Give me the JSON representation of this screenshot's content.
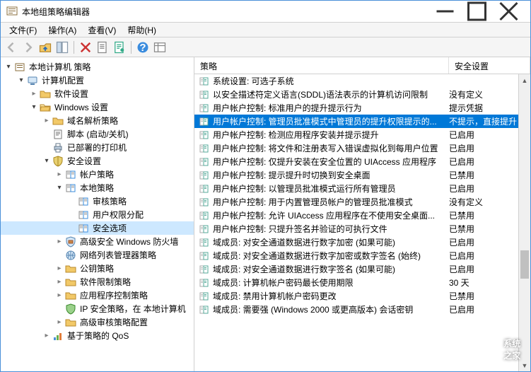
{
  "window": {
    "title": "本地组策略编辑器"
  },
  "menu": {
    "file": "文件(F)",
    "action": "操作(A)",
    "view": "查看(V)",
    "help": "帮助(H)"
  },
  "tree": {
    "root": "本地计算机 策略",
    "computer_config": "计算机配置",
    "software_settings": "软件设置",
    "windows_settings": "Windows 设置",
    "name_resolution": "域名解析策略",
    "scripts": "脚本 (启动/关机)",
    "deployed_printers": "已部署的打印机",
    "security_settings": "安全设置",
    "account_policies": "帐户策略",
    "local_policies": "本地策略",
    "audit_policy": "审核策略",
    "user_rights": "用户权限分配",
    "security_options": "安全选项",
    "advanced_firewall": "高级安全 Windows 防火墙",
    "network_list": "网络列表管理器策略",
    "public_key": "公钥策略",
    "software_restriction": "软件限制策略",
    "app_control": "应用程序控制策略",
    "ip_security": "IP 安全策略，在 本地计算机",
    "advanced_audit": "高级审核策略配置",
    "policy_qos": "基于策略的 QoS"
  },
  "list": {
    "col_policy": "策略",
    "col_setting": "安全设置",
    "rows": [
      {
        "policy": "系统设置: 可选子系统",
        "setting": ""
      },
      {
        "policy": "以安全描述符定义语言(SDDL)语法表示的计算机访问限制",
        "setting": "没有定义"
      },
      {
        "policy": "用户帐户控制: 标准用户的提升提示行为",
        "setting": "提示凭据"
      },
      {
        "policy": "用户帐户控制: 管理员批准模式中管理员的提升权限提示的...",
        "setting": "不提示，直接提升",
        "selected": true
      },
      {
        "policy": "用户帐户控制: 检测应用程序安装并提示提升",
        "setting": "已启用"
      },
      {
        "policy": "用户帐户控制: 将文件和注册表写入错误虚拟化到每用户位置",
        "setting": "已启用"
      },
      {
        "policy": "用户帐户控制: 仅提升安装在安全位置的 UIAccess 应用程序",
        "setting": "已启用"
      },
      {
        "policy": "用户帐户控制: 提示提升时切换到安全桌面",
        "setting": "已禁用"
      },
      {
        "policy": "用户帐户控制: 以管理员批准模式运行所有管理员",
        "setting": "已启用"
      },
      {
        "policy": "用户帐户控制: 用于内置管理员帐户的管理员批准模式",
        "setting": "没有定义"
      },
      {
        "policy": "用户帐户控制: 允许 UIAccess 应用程序在不使用安全桌面...",
        "setting": "已禁用"
      },
      {
        "policy": "用户帐户控制: 只提升签名并验证的可执行文件",
        "setting": "已禁用"
      },
      {
        "policy": "域成员: 对安全通道数据进行数字加密 (如果可能)",
        "setting": "已启用"
      },
      {
        "policy": "域成员: 对安全通道数据进行数字加密或数字签名 (始终)",
        "setting": "已启用"
      },
      {
        "policy": "域成员: 对安全通道数据进行数字签名 (如果可能)",
        "setting": "已启用"
      },
      {
        "policy": "域成员: 计算机帐户密码最长使用期限",
        "setting": "30 天"
      },
      {
        "policy": "域成员: 禁用计算机帐户密码更改",
        "setting": "已禁用"
      },
      {
        "policy": "域成员: 需要强 (Windows 2000 或更高版本) 会话密钥",
        "setting": "已启用"
      }
    ]
  },
  "watermark": "系统之家"
}
